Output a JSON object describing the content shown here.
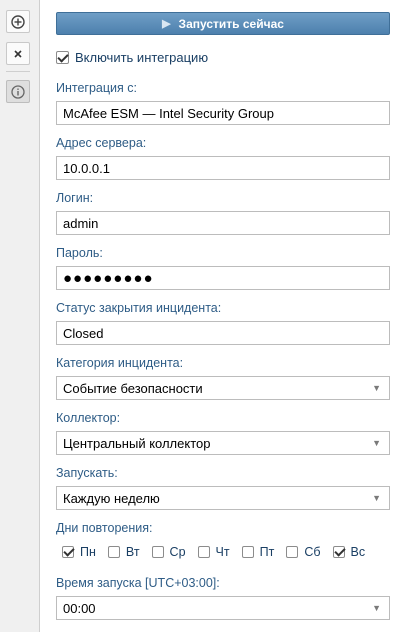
{
  "sidebar": {
    "add_icon": "plus-circle-icon",
    "close_icon": "close-icon",
    "info_icon": "info-icon"
  },
  "toolbar": {
    "run_label": "Запустить сейчас"
  },
  "enable": {
    "label": "Включить интеграцию",
    "checked": true
  },
  "fields": {
    "integration": {
      "label": "Интеграция с:",
      "value": "McAfee ESM — Intel Security Group"
    },
    "server": {
      "label": "Адрес сервера:",
      "value": "10.0.0.1"
    },
    "login": {
      "label": "Логин:",
      "value": "admin"
    },
    "password": {
      "label": "Пароль:",
      "value": "●●●●●●●●●"
    },
    "close_status": {
      "label": "Статус закрытия инцидента:",
      "value": "Closed"
    },
    "category": {
      "label": "Категория инцидента:",
      "value": "Событие безопасности"
    },
    "collector": {
      "label": "Коллектор:",
      "value": "Центральный коллектор"
    },
    "schedule": {
      "label": "Запускать:",
      "value": "Каждую неделю"
    },
    "repeat_days": {
      "label": "Дни повторения:",
      "days": [
        {
          "label": "Пн",
          "checked": true
        },
        {
          "label": "Вт",
          "checked": false
        },
        {
          "label": "Ср",
          "checked": false
        },
        {
          "label": "Чт",
          "checked": false
        },
        {
          "label": "Пт",
          "checked": false
        },
        {
          "label": "Сб",
          "checked": false
        },
        {
          "label": "Вс",
          "checked": true
        }
      ]
    },
    "start_time": {
      "label": "Время запуска [UTC+03:00]:",
      "value": "00:00"
    }
  },
  "colors": {
    "accent": "#4d80ad",
    "label": "#2e5c86"
  }
}
